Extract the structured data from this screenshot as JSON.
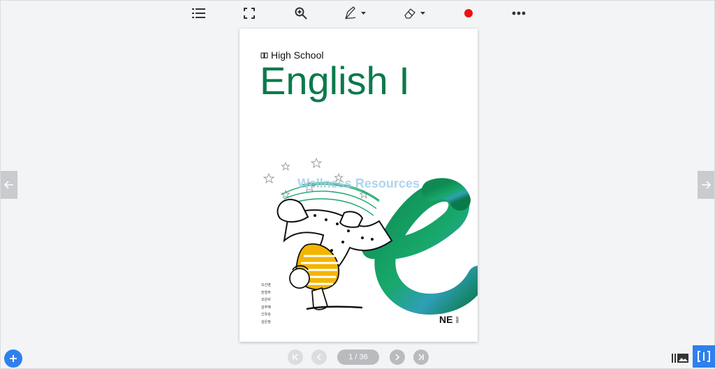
{
  "toolbar": {
    "items": [
      {
        "name": "list-icon"
      },
      {
        "name": "fullscreen-icon"
      },
      {
        "name": "zoom-in-icon"
      },
      {
        "name": "pen-icon"
      },
      {
        "name": "eraser-icon"
      },
      {
        "name": "record-icon"
      },
      {
        "name": "more-icon"
      }
    ],
    "record_color": "#ee1111"
  },
  "book": {
    "subtitle": "High School",
    "title": "English I",
    "watermark": "Wellness Resources",
    "authors": [
      "오선영",
      "전형주",
      "조은비",
      "김주혜",
      "신유승",
      "김은정"
    ],
    "publisher": "NE",
    "publisher_small": "능률",
    "brand_color": "#0b7a4b"
  },
  "pager": {
    "page_label": "1 / 36",
    "current_page": 1,
    "total_pages": 36
  },
  "colors": {
    "accent": "#2f80ed",
    "background": "#f3f4f6"
  }
}
